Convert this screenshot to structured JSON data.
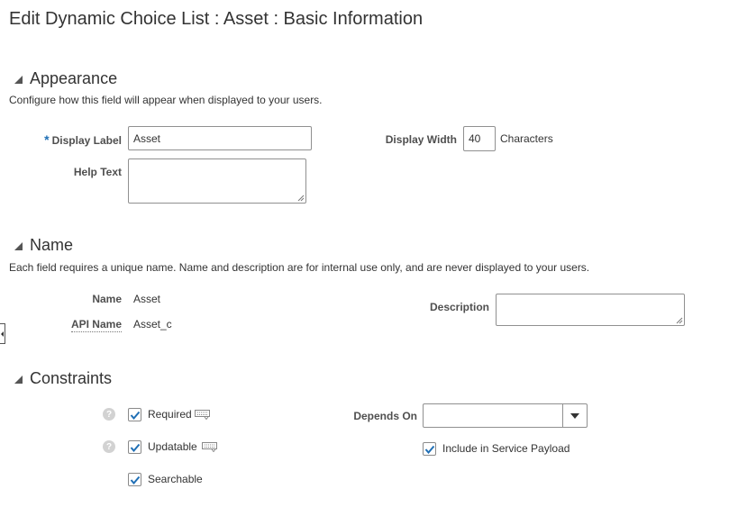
{
  "page": {
    "title": "Edit Dynamic Choice List : Asset : Basic Information"
  },
  "appearance": {
    "heading": "Appearance",
    "description": "Configure how this field will appear when displayed to your users.",
    "display_label": {
      "label": "Display Label",
      "value": "Asset",
      "required_marker": "*"
    },
    "help_text": {
      "label": "Help Text",
      "value": ""
    },
    "display_width": {
      "label": "Display Width",
      "value": "40",
      "suffix": "Characters"
    }
  },
  "name": {
    "heading": "Name",
    "description": "Each field requires a unique name. Name and description are for internal use only, and are never displayed to your users.",
    "name_field": {
      "label": "Name",
      "value": "Asset"
    },
    "api_name": {
      "label": "API Name",
      "value": "Asset_c"
    },
    "description_field": {
      "label": "Description",
      "value": ""
    }
  },
  "constraints": {
    "heading": "Constraints",
    "required": {
      "label": "Required",
      "checked": true
    },
    "updatable": {
      "label": "Updatable",
      "checked": true
    },
    "searchable": {
      "label": "Searchable",
      "checked": true
    },
    "depends_on": {
      "label": "Depends On",
      "value": ""
    },
    "include_in_service_payload": {
      "label": "Include in Service Payload",
      "checked": true
    }
  },
  "icons": {
    "help": "help-icon",
    "expression": "keyboard-icon",
    "dropdown": "chevron-down-icon",
    "collapse": "triangle-collapse-icon"
  },
  "colors": {
    "required_star": "#1f6fb5",
    "checkmark": "#1f6fb5",
    "text": "#333333",
    "label": "#4f4f4f"
  }
}
